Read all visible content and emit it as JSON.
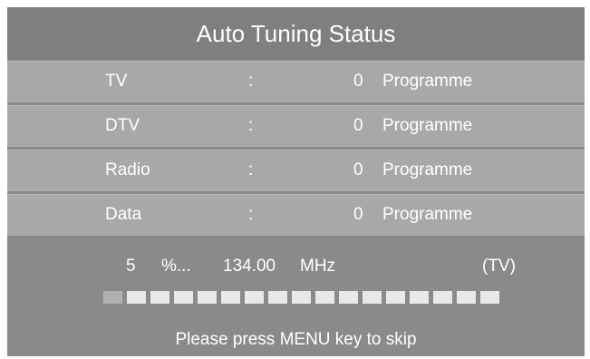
{
  "dialog": {
    "title": "Auto Tuning Status"
  },
  "rows": [
    {
      "label": "TV",
      "separator": ":",
      "count": "0",
      "unit": "Programme"
    },
    {
      "label": "DTV",
      "separator": ":",
      "count": "0",
      "unit": "Programme"
    },
    {
      "label": "Radio",
      "separator": ":",
      "count": "0",
      "unit": "Programme"
    },
    {
      "label": "Data",
      "separator": ":",
      "count": "0",
      "unit": "Programme"
    }
  ],
  "status": {
    "percent": "5",
    "percent_suffix": "%...",
    "frequency": "134.00",
    "frequency_unit": "MHz",
    "mode": "(TV)"
  },
  "progress": {
    "segments_total": 17,
    "segments_filled": 1,
    "fraction": 0.05
  },
  "hint": "Please press MENU key to skip",
  "colors": {
    "panel": "#8a8a8a",
    "title_bar": "#7f7f7f",
    "row": "#a8a8a8",
    "text": "#ffffff",
    "segment_empty": "#e8e8e8",
    "segment_filled": "#b0b0b0"
  }
}
